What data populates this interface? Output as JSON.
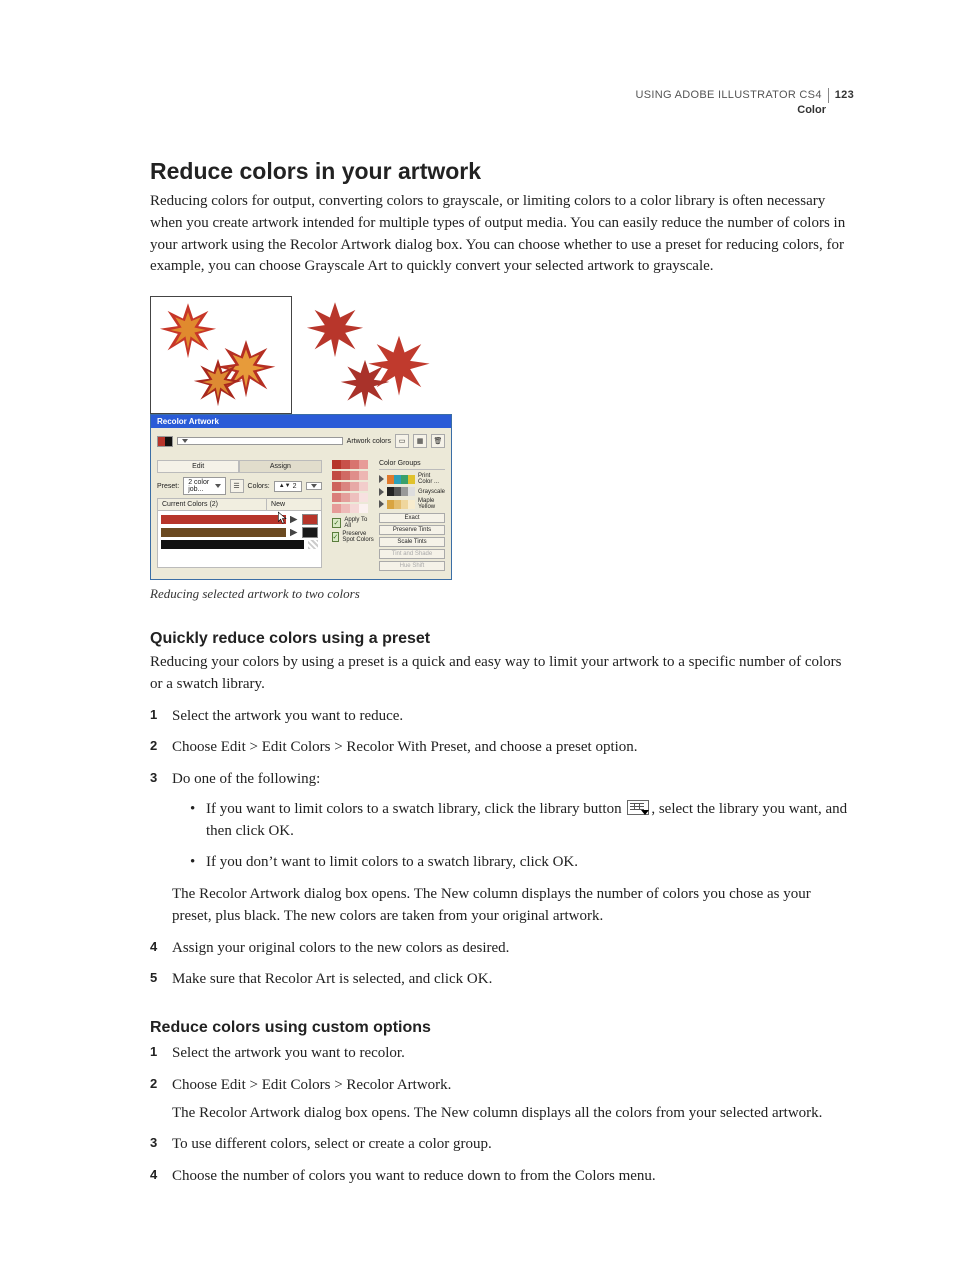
{
  "header": {
    "product": "USING ADOBE ILLUSTRATOR CS4",
    "section": "Color",
    "page": "123"
  },
  "h1": "Reduce colors in your artwork",
  "intro": "Reducing colors for output, converting colors to grayscale, or limiting colors to a color library is often necessary when you create artwork intended for multiple types of output media. You can easily reduce the number of colors in your artwork using the Recolor Artwork dialog box. You can choose whether to use a preset for reducing colors, for example, you can choose Grayscale Art to quickly convert your selected artwork to grayscale.",
  "figure": {
    "caption": "Reducing selected artwork to two colors",
    "dialog": {
      "title": "Recolor Artwork",
      "artwork_colors_label": "Artwork colors",
      "tabs": {
        "edit": "Edit",
        "assign": "Assign"
      },
      "preset_label": "Preset:",
      "preset_value": "2 color job...",
      "colors_label": "Colors:",
      "colors_value": "2",
      "current_label": "Current Colors (2)",
      "new_label": "New",
      "color_groups_label": "Color Groups",
      "groups": [
        {
          "name": "Print Color ..."
        },
        {
          "name": "Grayscale"
        },
        {
          "name": "Maple Yellow"
        }
      ],
      "buttons": {
        "exact": "Exact",
        "preserve_tints": "Preserve Tints",
        "scale_tints": "Scale Tints",
        "tint_shade": "Tint and Shade",
        "hue_shift": "Hue Shift"
      },
      "checks": {
        "apply_all": "Apply To All",
        "preserve_spot": "Preserve Spot Colors"
      }
    }
  },
  "section1": {
    "title": "Quickly reduce colors using a preset",
    "intro": "Reducing your colors by using a preset is a quick and easy way to limit your artwork to a specific number of colors or a swatch library.",
    "steps": {
      "s1": "Select the artwork you want to reduce.",
      "s2": "Choose Edit > Edit Colors > Recolor With Preset, and choose a preset option.",
      "s3": "Do one of the following:",
      "s3_b1a": "If you want to limit colors to a swatch library, click the library button ",
      "s3_b1b": ", select the library you want, and then click OK.",
      "s3_b2": "If you don’t want to limit colors to a swatch library, click OK.",
      "s3_after": "The Recolor Artwork dialog box opens. The New column displays the number of colors you chose as your preset, plus black. The new colors are taken from your original artwork.",
      "s4": "Assign your original colors to the new colors as desired.",
      "s5": "Make sure that Recolor Art is selected, and click OK."
    }
  },
  "section2": {
    "title": "Reduce colors using custom options",
    "steps": {
      "s1": "Select the artwork you want to recolor.",
      "s2": "Choose Edit > Edit Colors > Recolor Artwork.",
      "s2_after": "The Recolor Artwork dialog box opens. The New column displays all the colors from your selected artwork.",
      "s3": "To use different colors, select or create a color group.",
      "s4": "Choose the number of colors you want to reduce down to from the Colors menu."
    }
  }
}
